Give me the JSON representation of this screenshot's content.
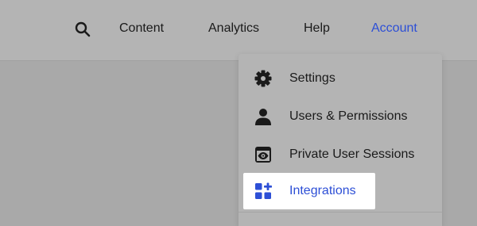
{
  "header": {
    "search_icon": "search-icon",
    "nav": [
      {
        "label": "Content"
      },
      {
        "label": "Analytics"
      },
      {
        "label": "Help"
      },
      {
        "label": "Account",
        "active": true
      }
    ]
  },
  "account_menu": {
    "items": [
      {
        "label": "Settings",
        "icon": "gear-icon"
      },
      {
        "label": "Users & Permissions",
        "icon": "user-icon"
      },
      {
        "label": "Private User Sessions",
        "icon": "eye-window-icon"
      },
      {
        "label": "Integrations",
        "icon": "integrations-icon",
        "highlighted": true
      }
    ]
  },
  "colors": {
    "accent": "#2d4fd6",
    "text": "#1a1a1a",
    "overlay_background": "#b4b4b4",
    "highlight_background": "#ffffff"
  }
}
